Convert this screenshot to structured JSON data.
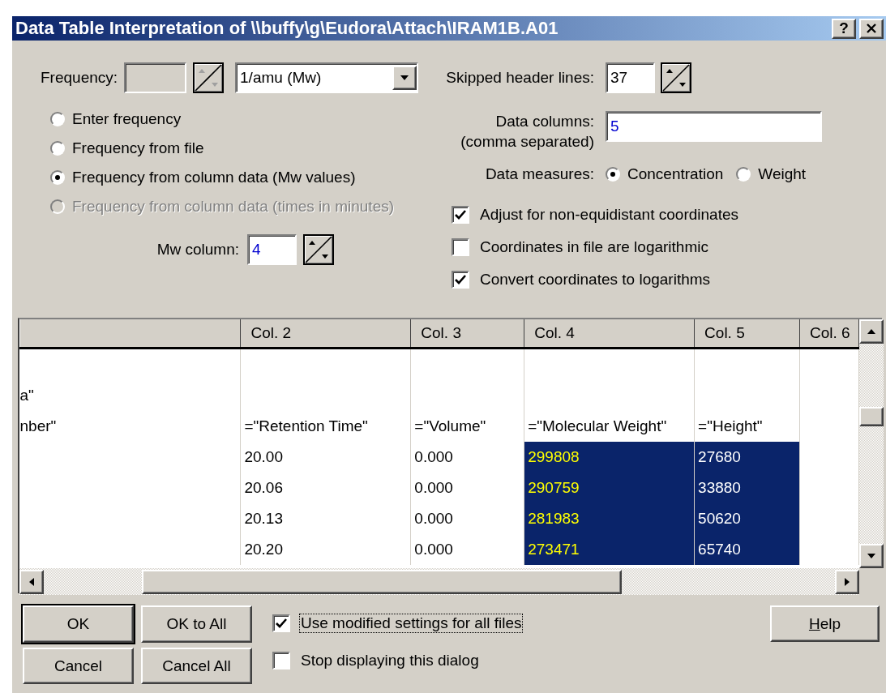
{
  "window": {
    "title": "Data Table Interpretation of \\\\buffy\\g\\Eudora\\Attach\\IRAM1B.A01",
    "help_button": "?"
  },
  "frequency": {
    "label": "Frequency:",
    "disabled": true,
    "unit": "1/amu (Mw)"
  },
  "frequency_source": [
    {
      "label": "Enter frequency",
      "selected": false,
      "disabled": false
    },
    {
      "label": "Frequency from file",
      "selected": false,
      "disabled": false
    },
    {
      "label": "Frequency from column data (Mw values)",
      "selected": true,
      "disabled": false
    },
    {
      "label": "Frequency from column data (times in minutes)",
      "selected": false,
      "disabled": true
    }
  ],
  "mw_column": {
    "label": "Mw column:",
    "value": "4"
  },
  "skipped_header_lines": {
    "label": "Skipped header lines:",
    "value": "37"
  },
  "data_columns": {
    "label": "Data columns:",
    "hint": "(comma separated)",
    "value": "5"
  },
  "data_measures": {
    "label": "Data measures:",
    "options": [
      {
        "label": "Concentration",
        "selected": true
      },
      {
        "label": "Weight",
        "selected": false
      }
    ]
  },
  "options": [
    {
      "label": "Adjust for non-equidistant coordinates",
      "checked": true
    },
    {
      "label": "Coordinates in file are logarithmic",
      "checked": false
    },
    {
      "label": "Convert coordinates to logarithms",
      "checked": true
    }
  ],
  "table": {
    "columns": [
      {
        "kind": "plain"
      },
      {
        "label": "Col. 2",
        "kind": "plain"
      },
      {
        "label": "Col. 3",
        "kind": "plain"
      },
      {
        "label": "Col. 4",
        "kind": "mw"
      },
      {
        "label": "Col. 5",
        "kind": "data"
      },
      {
        "label": "Col. 6",
        "kind": "plain"
      }
    ],
    "rows": [
      {
        "kind": "text",
        "cells": [
          "a\""
        ]
      },
      {
        "kind": "text",
        "cells": [
          "nber\"",
          "=\"Retention Time\"",
          "=\"Volume\"",
          "=\"Molecular Weight\"",
          "=\"Height\""
        ]
      },
      {
        "kind": "data",
        "cells": [
          null,
          "20.00",
          "0.000",
          "299808",
          "27680"
        ]
      },
      {
        "kind": "data",
        "cells": [
          null,
          "20.06",
          "0.000",
          "290759",
          "33880"
        ]
      },
      {
        "kind": "data",
        "cells": [
          null,
          "20.13",
          "0.000",
          "281983",
          "50620"
        ]
      },
      {
        "kind": "data",
        "cells": [
          null,
          "20.20",
          "0.000",
          "273471",
          "65740"
        ]
      }
    ]
  },
  "buttons": [
    {
      "label": "OK",
      "default": true
    },
    {
      "label": "OK to All",
      "default": false
    },
    {
      "label": "Cancel",
      "default": false
    },
    {
      "label": "Cancel All",
      "default": false
    }
  ],
  "file_options": [
    {
      "label": "Use modified settings for all files",
      "checked": true,
      "focused": true
    },
    {
      "label": "Stop displaying this dialog",
      "checked": false,
      "focused": false
    }
  ],
  "help_button": {
    "label": "Help"
  }
}
